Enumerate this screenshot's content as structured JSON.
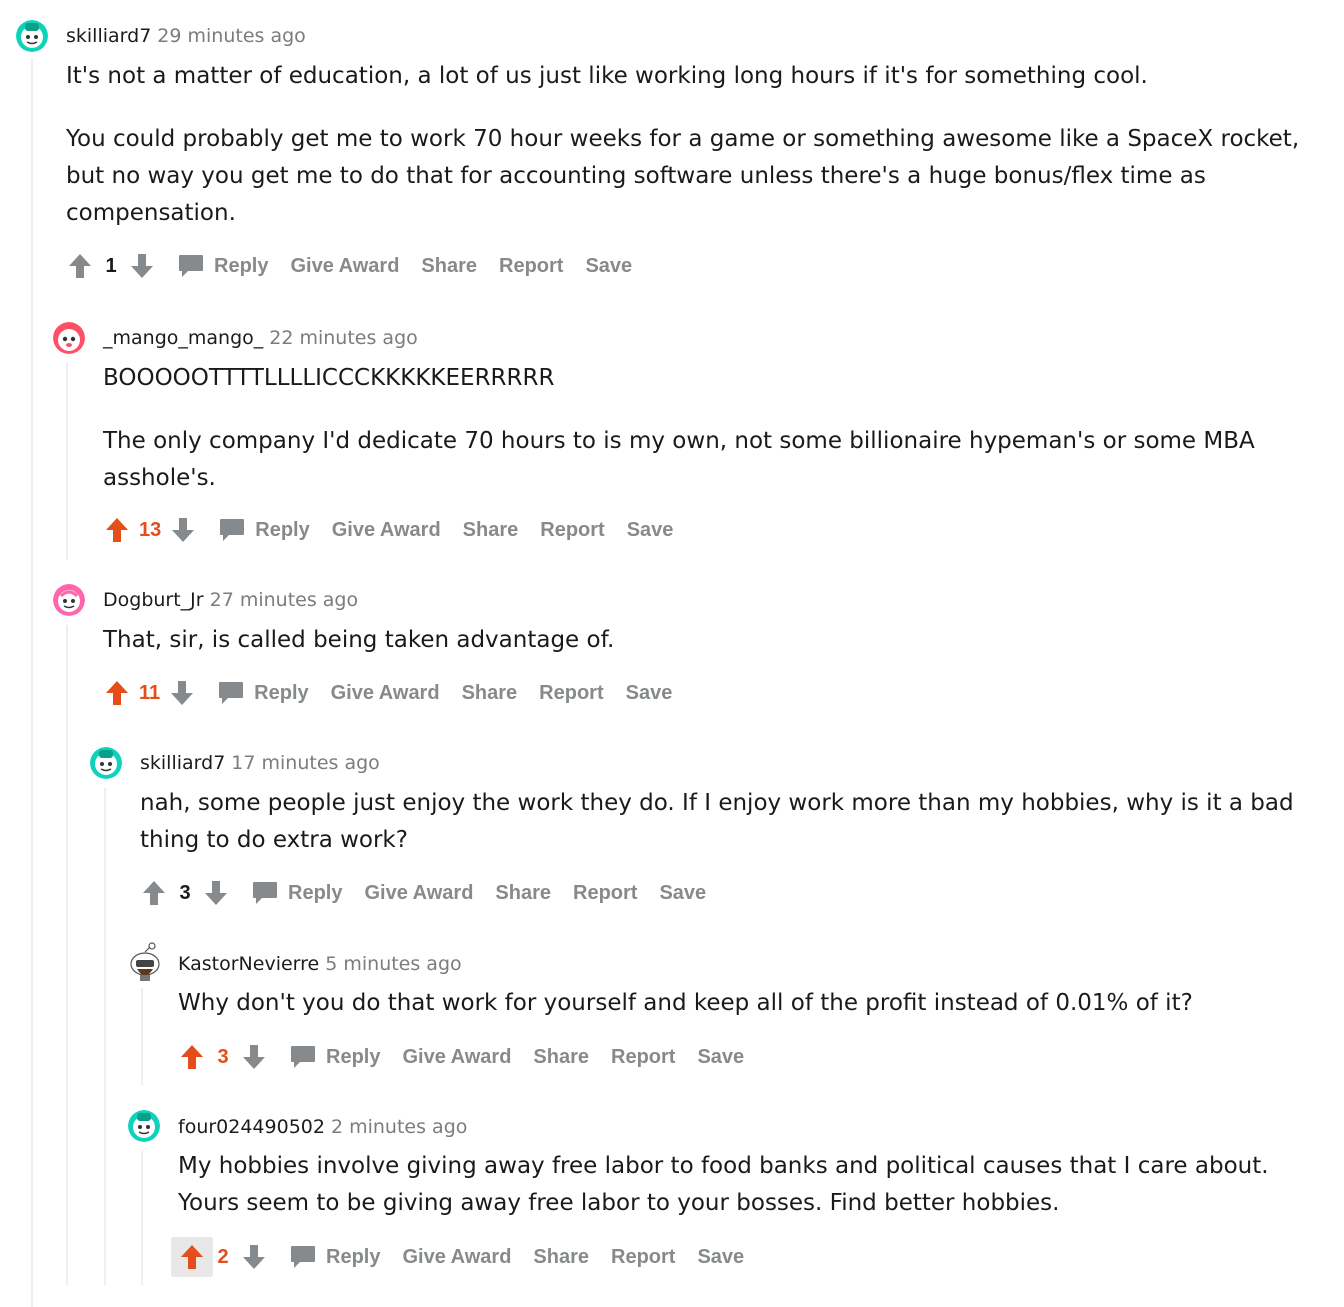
{
  "colors": {
    "upvoted": "#e54d1a",
    "neutral_arrow": "#878a8c",
    "muted": "#878a8c"
  },
  "actions": {
    "reply": "Reply",
    "give_award": "Give Award",
    "share": "Share",
    "report": "Report",
    "save": "Save"
  },
  "comments": [
    {
      "author": "skilliard7",
      "time": "29 minutes ago",
      "avatar": "snoo-green",
      "paragraphs": [
        "It's not a matter of education, a lot of us just like working long hours if it's for something cool.",
        "You could probably get me to work 70 hour weeks for a game or something awesome like a SpaceX rocket, but no way you get me to do that for accounting software unless there's a huge bonus/flex time as compensation."
      ],
      "score": "1",
      "upvoted": false
    },
    {
      "author": "_mango_mango_",
      "time": "22 minutes ago",
      "avatar": "snoo-red",
      "paragraphs": [
        "BOOOOOTTTTLLLLICCCKKKKKEERRRRR",
        "The only company I'd dedicate 70 hours to is my own, not some billionaire hypeman's or some MBA asshole's."
      ],
      "score": "13",
      "upvoted": true
    },
    {
      "author": "Dogburt_Jr",
      "time": "27 minutes ago",
      "avatar": "snoo-pink",
      "paragraphs": [
        "That, sir, is called being taken advantage of."
      ],
      "score": "11",
      "upvoted": true
    },
    {
      "author": "skilliard7",
      "time": "17 minutes ago",
      "avatar": "snoo-green",
      "paragraphs": [
        "nah, some people just enjoy the work they do. If I enjoy work more than my hobbies, why is it a bad thing to do extra work?"
      ],
      "score": "3",
      "upvoted": false
    },
    {
      "author": "KastorNevierre",
      "time": "5 minutes ago",
      "avatar": "snoo-custom",
      "paragraphs": [
        "Why don't you do that work for yourself and keep all of the profit instead of 0.01% of it?"
      ],
      "score": "3",
      "upvoted": true
    },
    {
      "author": "four024490502",
      "time": "2 minutes ago",
      "avatar": "snoo-green",
      "paragraphs": [
        "My hobbies involve giving away free labor to food banks and political causes that I care about. Yours seem to be giving away free labor to your bosses. Find better hobbies."
      ],
      "score": "2",
      "upvoted": true
    }
  ]
}
